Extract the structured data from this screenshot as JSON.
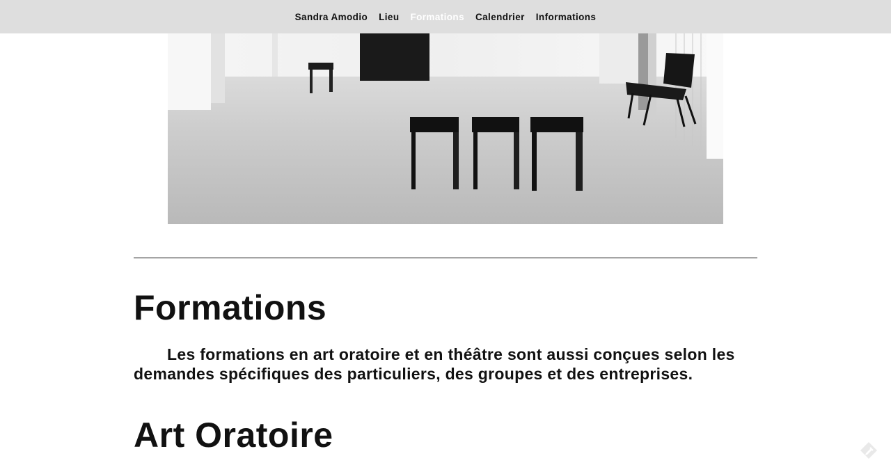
{
  "nav": {
    "items": [
      {
        "label": "Sandra Amodio",
        "active": false
      },
      {
        "label": "Lieu",
        "active": false
      },
      {
        "label": "Formations",
        "active": true
      },
      {
        "label": "Calendrier",
        "active": false
      },
      {
        "label": "Informations",
        "active": false
      }
    ]
  },
  "section": {
    "title": "Formations",
    "intro": "Les formations en art oratoire et en théâtre sont aussi conçues selon les demandes spécifiques des particuliers, des groupes et des entreprises.",
    "subtitle": "Art Oratoire"
  },
  "colors": {
    "nav_background": "#dedede",
    "nav_active": "#ffffff",
    "text": "#111111"
  },
  "icons": {
    "corner": "pencil-icon"
  }
}
